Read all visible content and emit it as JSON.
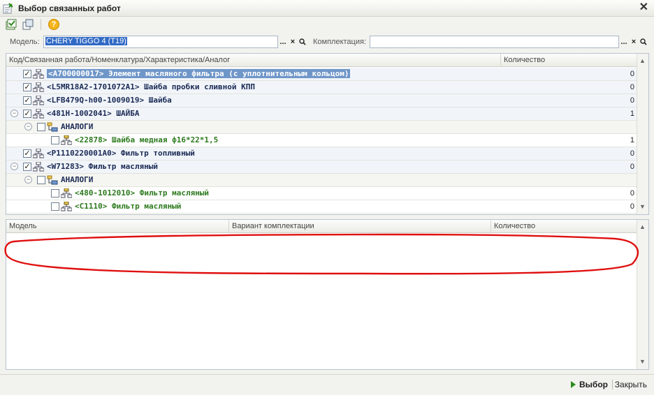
{
  "window": {
    "title": "Выбор связанных работ"
  },
  "filters": {
    "model_label": "Модель:",
    "model_value": "CHERY TIGGO 4 (T19)",
    "config_label": "Комплектация:",
    "config_value": "",
    "ellipsis": "...",
    "clear": "×"
  },
  "upper_grid": {
    "headers": [
      "Код/Связанная работа/Номенклатура/Характеристика/Аналог",
      "Количество"
    ],
    "rows": [
      {
        "text": "<A700000017> Элемент масляного фильтра (с уплотнительным кольцом)",
        "qty": "0",
        "checked": true,
        "kind": "work",
        "selected": true
      },
      {
        "text": "<L5MR18A2-1701072A1> Шайба пробки сливной КПП",
        "qty": "0",
        "checked": true,
        "kind": "work"
      },
      {
        "text": "<LFB479Q-h00-1009019> Шайба",
        "qty": "0",
        "checked": true,
        "kind": "work"
      },
      {
        "text": "<481H-1002041> ШАЙБА",
        "qty": "1",
        "checked": true,
        "kind": "work",
        "expanded": true
      },
      {
        "text": "АНАЛОГИ",
        "qty": "",
        "checked": false,
        "kind": "group",
        "expanded": true
      },
      {
        "text": "<22878> Шайба медная ф16*22*1,5",
        "qty": "1",
        "checked": false,
        "kind": "analog"
      },
      {
        "text": "<P1110220001A0> Фильтр топливный",
        "qty": "0",
        "checked": true,
        "kind": "work"
      },
      {
        "text": "<W71283> Фильтр масляный",
        "qty": "0",
        "checked": true,
        "kind": "work",
        "expanded": true
      },
      {
        "text": "АНАЛОГИ",
        "qty": "",
        "checked": false,
        "kind": "group",
        "expanded": true
      },
      {
        "text": "<480-1012010> Фильтр масляный",
        "qty": "0",
        "checked": false,
        "kind": "analog"
      },
      {
        "text": "<C1110> Фильтр масляный",
        "qty": "0",
        "checked": false,
        "kind": "analog"
      }
    ]
  },
  "lower_grid": {
    "headers": [
      "Модель",
      "Вариант комплектации",
      "Количество"
    ]
  },
  "buttons": {
    "select": "Выбор",
    "close": "Закрыть"
  },
  "icons": [
    "window-icon",
    "close-icon",
    "check-all-icon",
    "copy-icon",
    "help-icon",
    "search-icon",
    "tree-item-icon",
    "group-folder-icon",
    "select-arrow-icon",
    "scroll-up-icon",
    "scroll-down-icon"
  ],
  "colors": {
    "accent": "#316ac5",
    "analog_text": "#2d7a1e",
    "work_text": "#1a2a55",
    "select_arrow": "#2e8b1f",
    "annotation": "#e01010"
  }
}
